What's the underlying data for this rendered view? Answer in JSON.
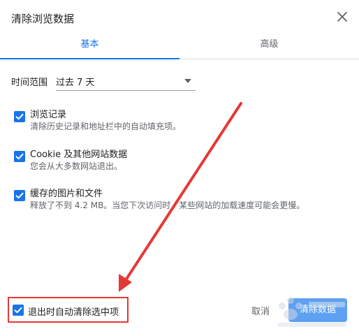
{
  "dialog": {
    "title": "清除浏览数据",
    "close_icon": "close-icon"
  },
  "tabs": [
    {
      "label": "基本",
      "active": true
    },
    {
      "label": "高级",
      "active": false
    }
  ],
  "time_range": {
    "label": "时间范围",
    "selected": "过去 7 天"
  },
  "items": [
    {
      "title": "浏览记录",
      "desc": "清除历史记录和地址栏中的自动填充项。",
      "checked": true
    },
    {
      "title": "Cookie 及其他网站数据",
      "desc": "您会从大多数网站退出。",
      "checked": true
    },
    {
      "title": "缓存的图片和文件",
      "desc": "释放了不到 4.2 MB。当您下次访问时，某些网站的加载速度可能会更慢。",
      "checked": true
    }
  ],
  "footer": {
    "auto_clear_label": "退出时自动清除选中项",
    "auto_clear_checked": true,
    "cancel_label": "取消",
    "clear_label": "清除数据"
  },
  "colors": {
    "accent": "#1a73e8",
    "annotation_red": "#e53935"
  }
}
